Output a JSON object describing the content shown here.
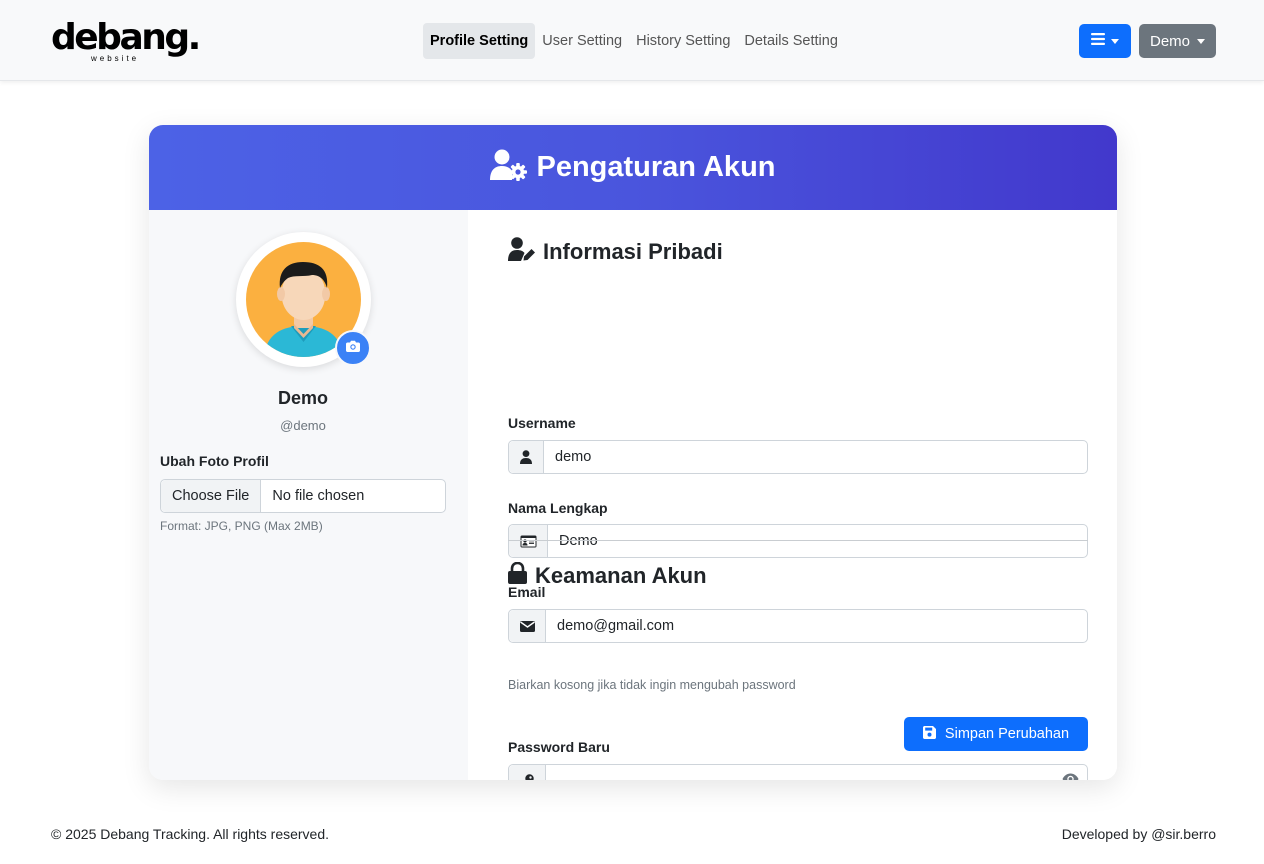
{
  "brand": {
    "main": "debang.",
    "sub": "website"
  },
  "nav": {
    "links": [
      {
        "label": "Profile Setting",
        "active": true
      },
      {
        "label": "User Setting",
        "active": false
      },
      {
        "label": "History Setting",
        "active": false
      },
      {
        "label": "Details Setting",
        "active": false
      }
    ],
    "menu_icon": "bars-icon",
    "user_label": "Demo"
  },
  "card": {
    "title": "Pengaturan Akun",
    "title_icon": "user-gear-icon"
  },
  "profile": {
    "name": "Demo",
    "handle": "@demo",
    "photo_label": "Ubah Foto Profil",
    "file_button": "Choose File",
    "file_status": "No file chosen",
    "photo_help": "Format: JPG, PNG (Max 2MB)"
  },
  "personal": {
    "title": "Informasi Pribadi",
    "username_label": "Username",
    "username_value": "demo",
    "fullname_label": "Nama Lengkap",
    "fullname_value": "Demo",
    "email_label": "Email",
    "email_value": "demo@gmail.com"
  },
  "security": {
    "title": "Keamanan Akun",
    "password_label": "Password Baru",
    "password_value": "",
    "password_help": "Biarkan kosong jika tidak ingin mengubah password"
  },
  "actions": {
    "save_label": "Simpan Perubahan"
  },
  "footer": {
    "left": "© 2025 Debang Tracking. All rights reserved.",
    "right": "Developed by @sir.berro"
  },
  "colors": {
    "primary": "#0d6efd",
    "secondary": "#6c757d",
    "header_gradient_start": "#4c62e6",
    "header_gradient_end": "#4238cc"
  }
}
